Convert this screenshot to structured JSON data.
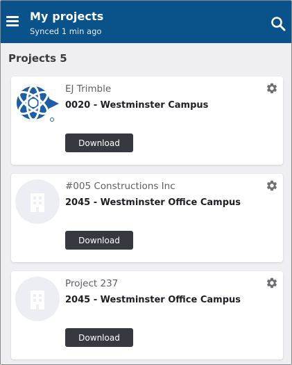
{
  "header": {
    "title": "My projects",
    "subtitle": "Synced 1 min ago",
    "background": "#0a528a"
  },
  "section": {
    "label": "Projects 5"
  },
  "projects": [
    {
      "organization": "EJ Trimble",
      "name": "0020 - Westminster Campus",
      "download_label": "Download",
      "thumbnail": "globe-logo-icon"
    },
    {
      "organization": "#005 Constructions Inc",
      "name": "2045 - Westminster Office Campus",
      "download_label": "Download",
      "thumbnail": "building-icon"
    },
    {
      "organization": "Project 237",
      "name": "2045 - Westminster Office Campus",
      "download_label": "Download",
      "thumbnail": "building-icon"
    }
  ],
  "colors": {
    "accent": "#0a528a",
    "button": "#363a40",
    "background": "#efeff3",
    "logo": "#1c5fa8"
  }
}
